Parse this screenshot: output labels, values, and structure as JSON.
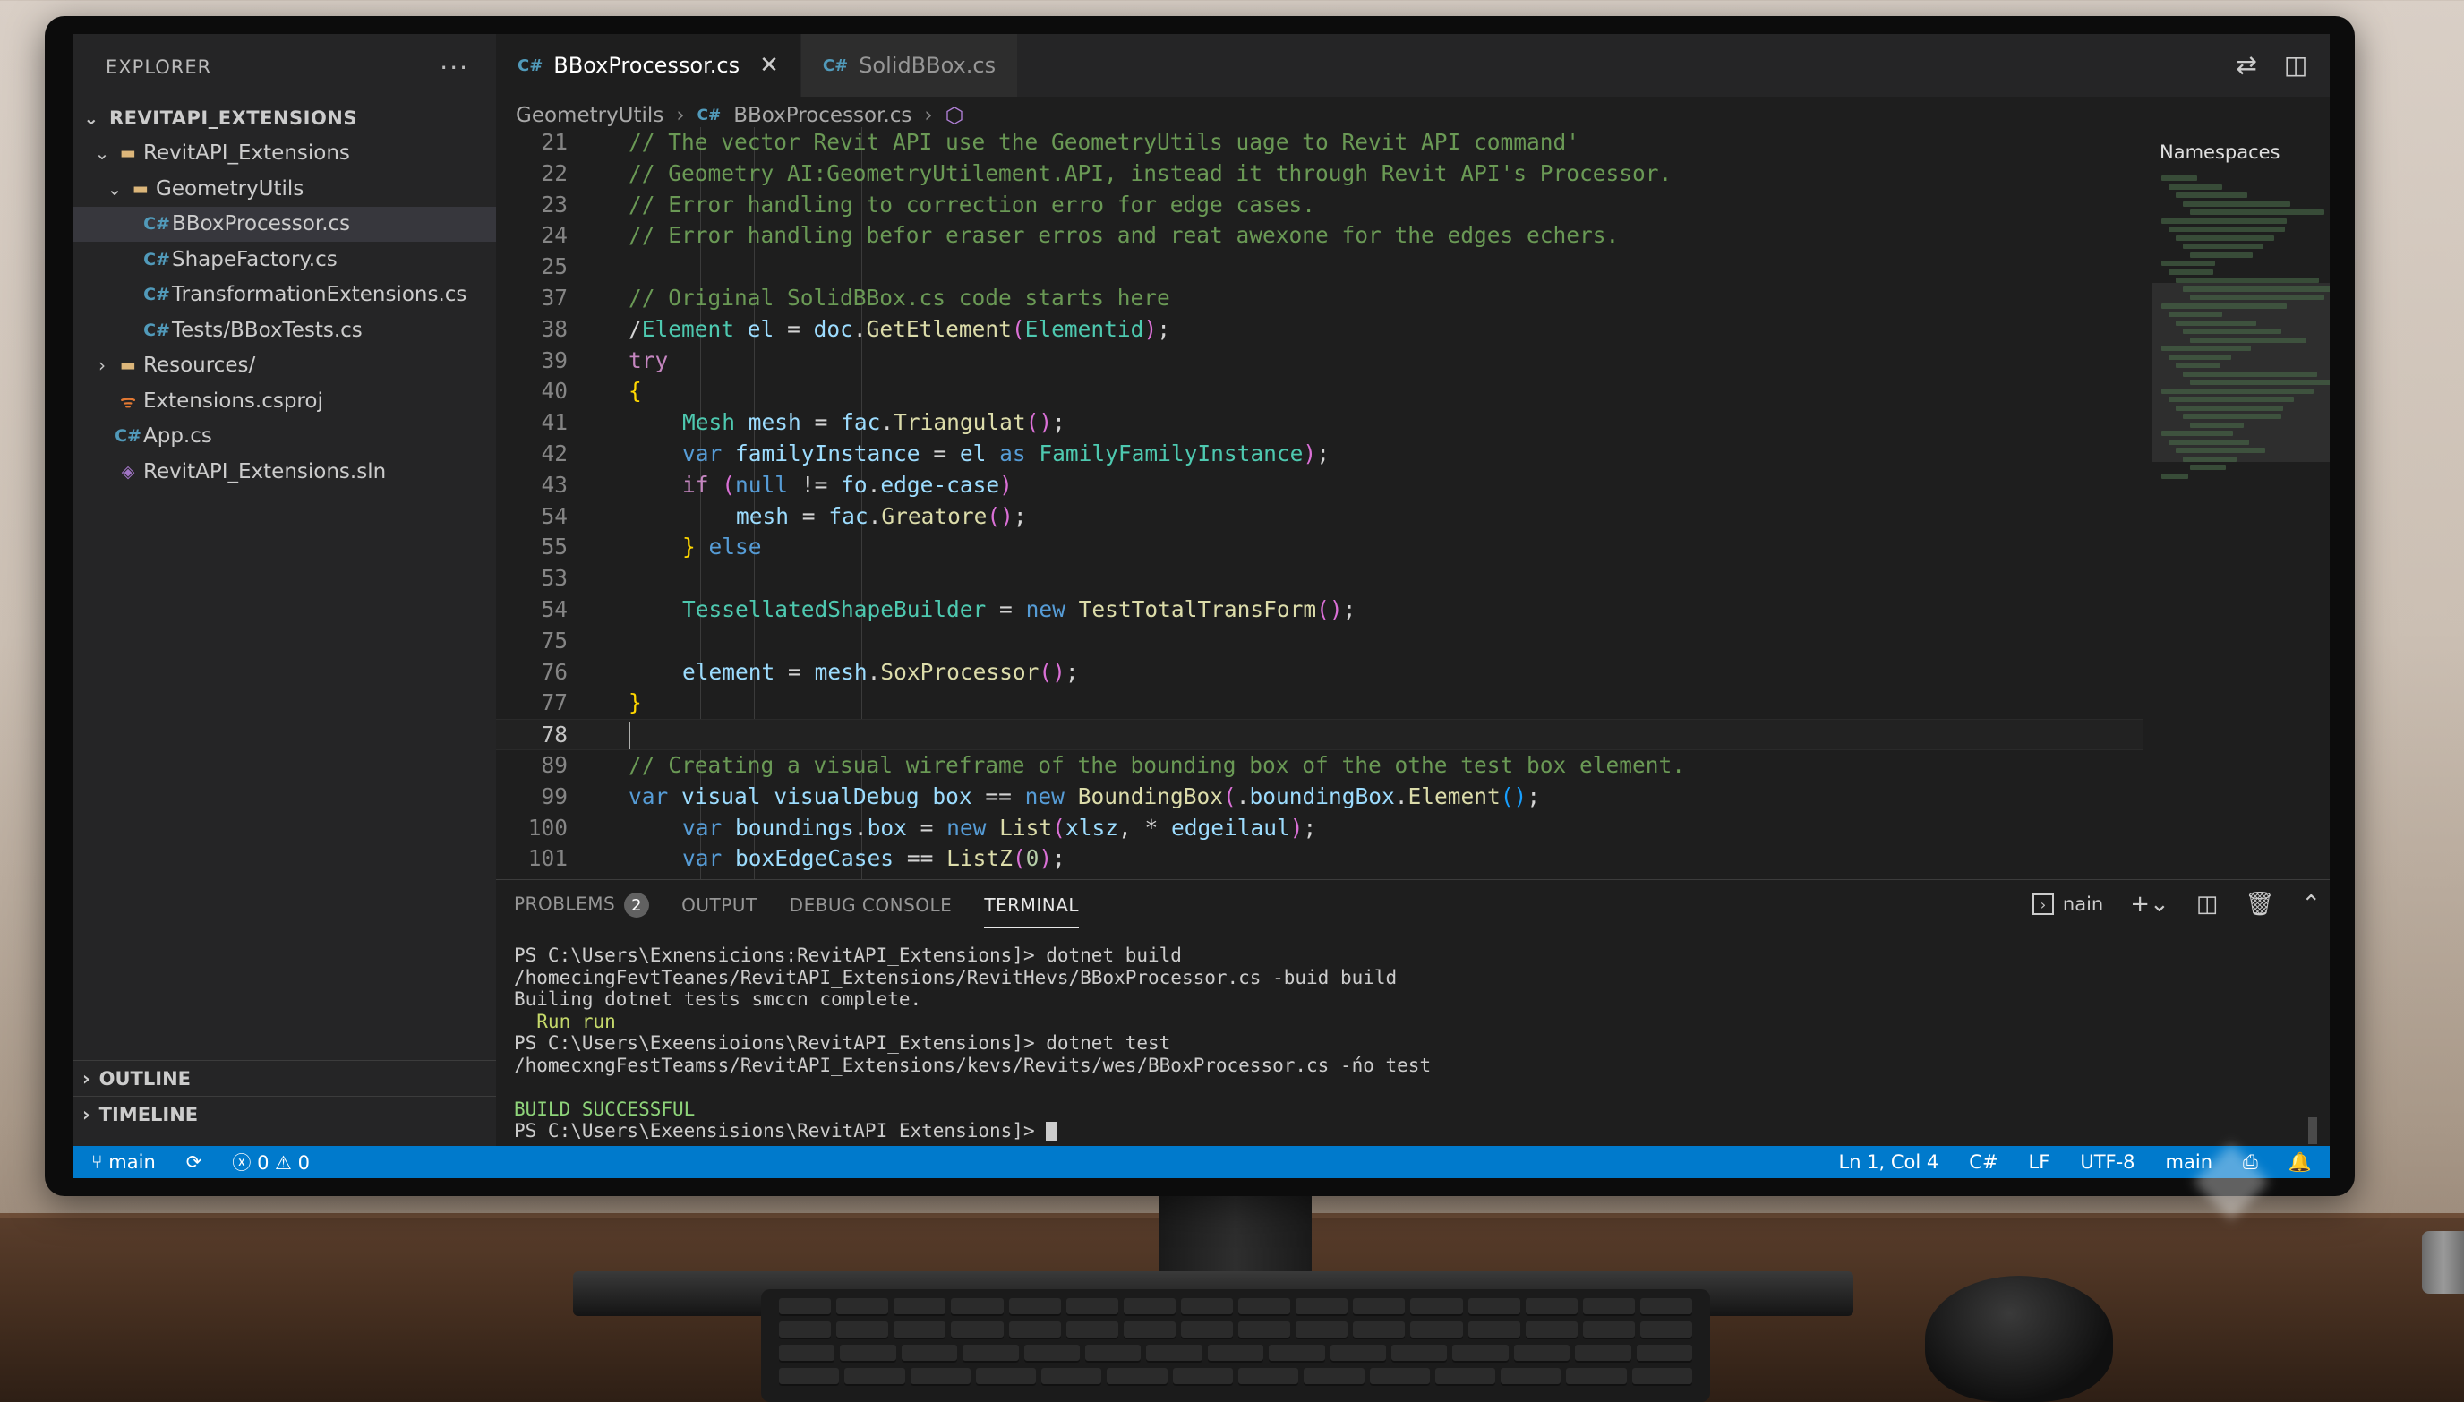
{
  "sidebar": {
    "header": "EXPLORER",
    "more": "···",
    "root": "REVITAPI_EXTENSIONS",
    "items": [
      {
        "label": "RevitAPI_Extensions",
        "icon": "folder-open-icon"
      },
      {
        "label": "GeometryUtils",
        "icon": "folder-open-icon"
      },
      {
        "label": "BBoxProcessor.cs",
        "icon": "csharp-file-icon"
      },
      {
        "label": "ShapeFactory.cs",
        "icon": "csharp-file-icon"
      },
      {
        "label": "TransformationExtensions.cs",
        "icon": "csharp-file-icon"
      },
      {
        "label": "Tests/BBoxTests.cs",
        "icon": "csharp-file-icon"
      },
      {
        "label": "Resources/",
        "icon": "folder-icon"
      },
      {
        "label": "Extensions.csproj",
        "icon": "rss-icon"
      },
      {
        "label": "App.cs",
        "icon": "csharp-file-icon"
      },
      {
        "label": "RevitAPI_Extensions.sln",
        "icon": "solution-icon"
      }
    ],
    "outline": "OUTLINE",
    "timeline": "TIMELINE"
  },
  "tabs": [
    {
      "label": "BBoxProcessor.cs",
      "close": "✕"
    },
    {
      "label": "SolidBBox.cs"
    }
  ],
  "breadcrumb": {
    "folder": "GeometryUtils",
    "file": "BBoxProcessor.cs"
  },
  "namespaces_title": "Namespaces",
  "code_lines": [
    {
      "n": "21",
      "t": "// The vector Revit API use the GeometryUtils uage to Revit API command'"
    },
    {
      "n": "22",
      "t": "// Geometry AI:GeometryUtilement.API, instead it through Revit API's Processor."
    },
    {
      "n": "23",
      "t": "// Error handling to correction erro for edge cases."
    },
    {
      "n": "24",
      "t": "// Error handling befor eraser erros and reat awexone for the edges echers."
    },
    {
      "n": "25",
      "t": ""
    },
    {
      "n": "37",
      "t": "// Original SolidBBox.cs code starts here"
    },
    {
      "n": "38",
      "t": "/Element el = doc.GetEtlement(Elementid);"
    },
    {
      "n": "39",
      "t": "try"
    },
    {
      "n": "40",
      "t": "{"
    },
    {
      "n": "41",
      "t": "Mesh mesh = fac.Triangulat();"
    },
    {
      "n": "42",
      "t": "var familyInstance = el as FamilyFamilyInstance);"
    },
    {
      "n": "43",
      "t": "if (null != fo.edge-case)"
    },
    {
      "n": "54",
      "t": "mesh = fac.Greatore();"
    },
    {
      "n": "55",
      "t": "} else"
    },
    {
      "n": "53",
      "t": ""
    },
    {
      "n": "54",
      "t": "TessellatedShapeBuilder = new TestTotalTransForm();"
    },
    {
      "n": "75",
      "t": ""
    },
    {
      "n": "76",
      "t": "element = mesh.SoxProcessor();"
    },
    {
      "n": "77",
      "t": "}"
    },
    {
      "n": "78",
      "t": ""
    },
    {
      "n": "89",
      "t": "// Creating a visual wireframe of the bounding box of the othe test box element."
    },
    {
      "n": "99",
      "t": "var visual visualDebug box == new BoundingBox(.boundingBox.Element();"
    },
    {
      "n": "100",
      "t": "var boundings.box = new List(xlsz, * edgeilaul);"
    },
    {
      "n": "101",
      "t": "var boxEdgeCases == ListZ(0);"
    }
  ],
  "panel": {
    "tabs": [
      "PROBLEMS",
      "OUTPUT",
      "DEBUG CONSOLE",
      "TERMINAL"
    ],
    "problems_count": "2",
    "shell_name": "nain",
    "terminal_lines": [
      "PS C:\\Users\\Exnensicions:RevitAPI_Extensions]> dotnet build",
      "/homecingFevtTeanes/RevitAPI_Extensions/RevitHevs/BBoxProcessor.cs -buid build",
      "Builing dotnet tests smccn complete.",
      "  Run run",
      "PS C:\\Users\\Exeensioions\\RevitAPI_Extensions]> dotnet test",
      "/homecxngFestTeamss/RevitAPI_Extensions/kevs/Revits/wes/BBoxProcessor.cs -ńo test",
      "",
      "BUILD SUCCESSFUL",
      "PS C:\\Users\\Exeensisions\\RevitAPI_Extensions]> "
    ]
  },
  "status": {
    "branch": "main",
    "errors": "0",
    "warnings": "0",
    "position": "Ln 1, Col 4",
    "language": "C#",
    "eol": "LF",
    "encoding": "UTF-8",
    "branch_right": "main"
  },
  "colors": {
    "statusbar": "#007acc",
    "editor_bg": "#1e1e1e",
    "sidebar_bg": "#252526",
    "comment": "#6a9955",
    "keyword": "#569cd6"
  }
}
